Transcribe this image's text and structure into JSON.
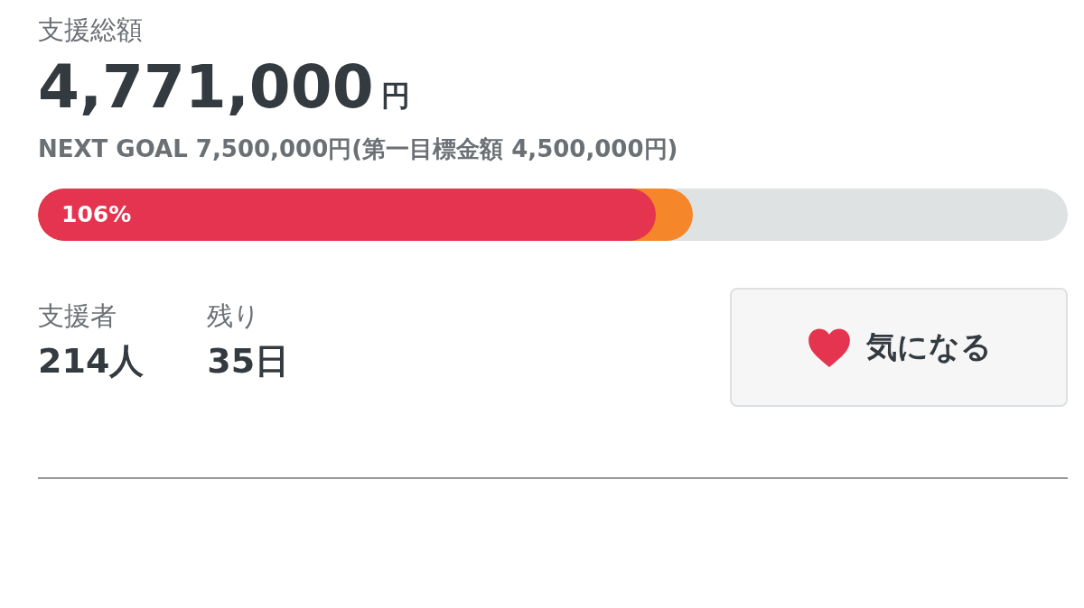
{
  "total_label": "支援総額",
  "total_amount": "4,771,000",
  "total_unit": "円",
  "next_goal": "NEXT GOAL 7,500,000円(第一目標金額 4,500,000円)",
  "progress": {
    "label": "106%",
    "segments": [
      {
        "level": 0.6,
        "color": "#e5344f"
      },
      {
        "level": 0.636,
        "color": "#f5862a"
      }
    ]
  },
  "stats": [
    {
      "label": "支援者",
      "value": "214人"
    },
    {
      "label": "残り",
      "value": "35日"
    }
  ],
  "favorite_button": {
    "label": "気になる"
  }
}
